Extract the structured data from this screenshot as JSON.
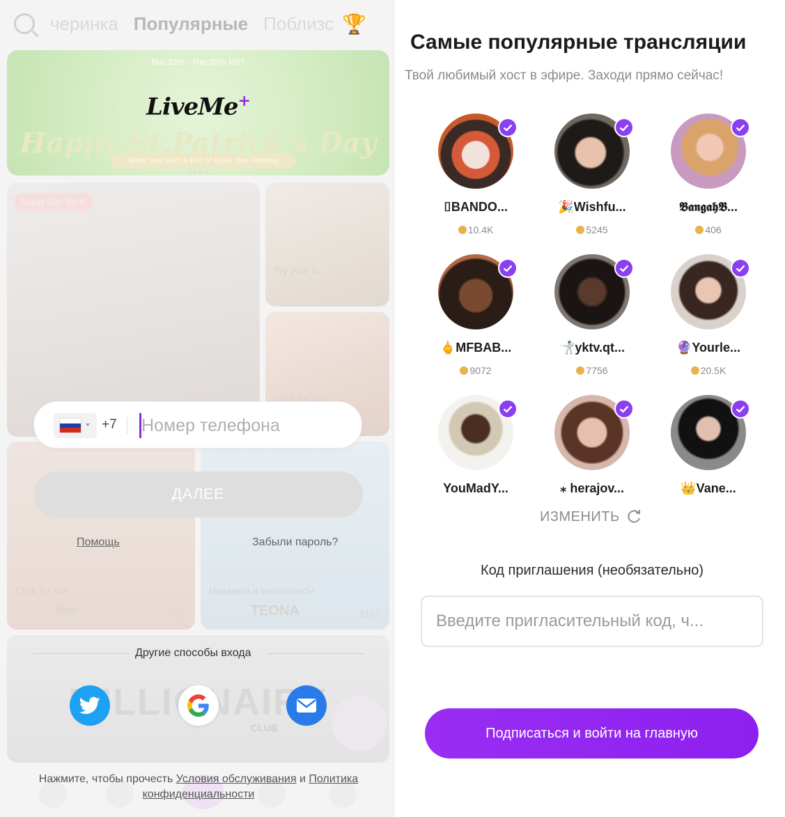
{
  "left": {
    "tabs": [
      "черинка",
      "Популярные",
      "Поблизс"
    ],
    "banner": {
      "dates": "Mar.12th - Mar.20th EST",
      "logo": "LiveMe",
      "logo_plus": "+",
      "bg_text": "Happy St.Patrick's Day",
      "ribbon": "Wish You Won A Pot of Gold This Holiday"
    },
    "tiles": {
      "super_star": "Super Star No.9",
      "t2_caption": "Try your lu...",
      "t2_views": "863",
      "t3_caption": "Click for fun!",
      "t3_views": "303",
      "t4_caption": "Click for fun!",
      "t4_name": "Bee",
      "t4_views": "711",
      "t5_caption": "Нажмите и веселитесь!",
      "t5_name": "TEONA",
      "t5_views": "1117",
      "t6_text": "MILLIONAIRE",
      "t6_club": "CLUB"
    },
    "phone": {
      "dial_code": "+7",
      "placeholder": "Номер телефона"
    },
    "next_label": "ДАЛЕЕ",
    "help_label": "Помощь",
    "forgot_label": "Забыли пароль?",
    "other_methods_label": "Другие способы входа",
    "terms": {
      "prefix": "Нажмите, чтобы прочесть",
      "terms_link": "Условия обслуживания",
      "and": "и",
      "privacy_link_1": "Политика",
      "privacy_link_2": "конфиденциальности"
    }
  },
  "right": {
    "title": "Самые популярные трансляции",
    "subtitle": "Твой любимый хост в эфире. Заходи прямо сейчас!",
    "hosts": [
      {
        "name": "⌷BANDO...",
        "views": "10.4K"
      },
      {
        "name": "🎉Wishfu...",
        "views": "5245"
      },
      {
        "name": "𝕭𝖆𝖓𝖌𝖆𝖍𝕭...",
        "views": "406"
      },
      {
        "name": "🖕MFBAB...",
        "views": "9072"
      },
      {
        "name": "🤺yktv.qt...",
        "views": "7756"
      },
      {
        "name": "🔮Yourle...",
        "views": "20.5K"
      },
      {
        "name": "YouMadY...",
        "views": ""
      },
      {
        "name": "⁎ herajov...",
        "views": ""
      },
      {
        "name": "👑Vane...",
        "views": ""
      }
    ],
    "change_label": "ИЗМЕНИТЬ",
    "invite_label": "Код приглашения (необязательно)",
    "invite_placeholder": "Введите пригласительный код, ч...",
    "subscribe_label": "Подписаться и войти на главную"
  }
}
